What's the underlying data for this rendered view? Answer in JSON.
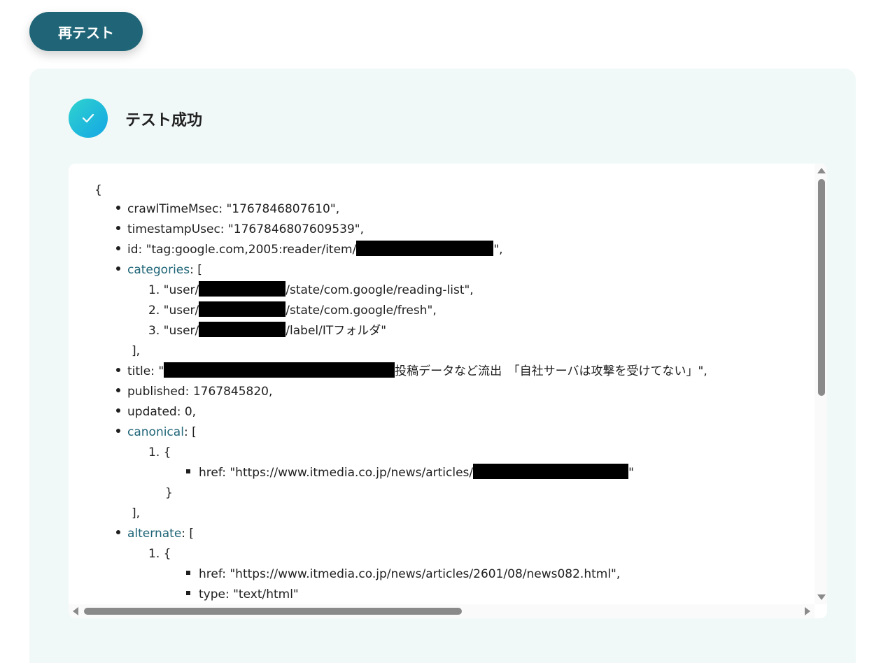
{
  "retest_button": {
    "label": "再テスト"
  },
  "result": {
    "status_icon": "check-icon",
    "status_text": "テスト成功"
  },
  "output": {
    "open_brace": "{",
    "crawl_time": "crawlTimeMsec: \"1767846807610\",",
    "timestamp": "timestampUsec: \"1767846807609539\",",
    "id_prefix": "id: \"tag:google.com,2005:reader/item/",
    "id_suffix": "\",",
    "categories_key": "categories",
    "categories_open": ": [",
    "categories": [
      {
        "index": "1.",
        "prefix": "\"user/",
        "suffix": "/state/com.google/reading-list\","
      },
      {
        "index": "2.",
        "prefix": "\"user/",
        "suffix": "/state/com.google/fresh\","
      },
      {
        "index": "3.",
        "prefix": "\"user/",
        "suffix": "/label/ITフォルダ\""
      }
    ],
    "categories_close": "],",
    "title_prefix": "title: \"",
    "title_suffix": "投稿データなど流出　「自社サーバは攻撃を受けてない」\",",
    "published": "published: 1767845820,",
    "updated": "updated: 0,",
    "canonical_key": "canonical",
    "canonical_open": ": [",
    "canonical_item_open": "1. {",
    "canonical_href_prefix": "href: \"https://www.itmedia.co.jp/news/articles/",
    "canonical_href_suffix": "\"",
    "canonical_item_close": "}",
    "canonical_close": "],",
    "alternate_key": "alternate",
    "alternate_open": ": [",
    "alternate_item_open": "1. {",
    "alternate_href": "href: \"https://www.itmedia.co.jp/news/articles/2601/08/news082.html\",",
    "alternate_type": "type: \"text/html\""
  }
}
